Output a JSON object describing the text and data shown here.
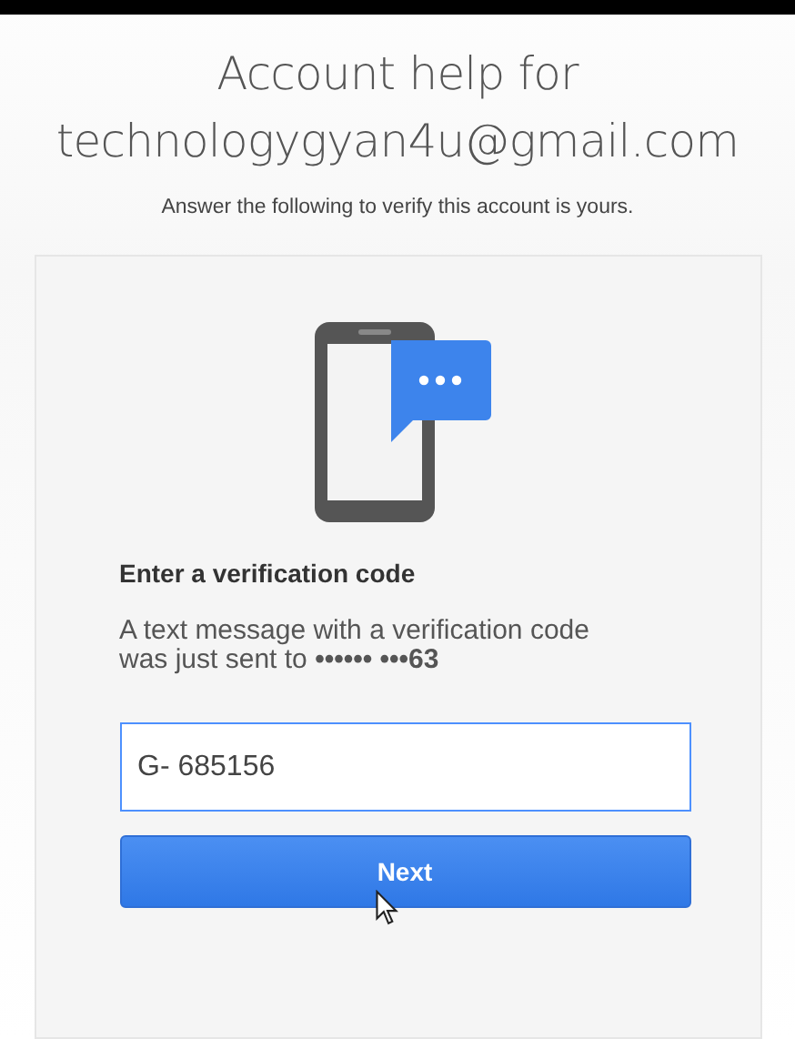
{
  "header": {
    "title_line_1": "Account help for",
    "title_line_2": "technologygyan4u@gmail.com",
    "subtitle": "Answer the following to verify this account is yours."
  },
  "card": {
    "heading": "Enter a verification code",
    "message": "A text message with a verification code was just sent to **•••••• •••63**",
    "code_field": {
      "value": "G- 685156",
      "focused": true
    },
    "next_button": "Next"
  }
}
